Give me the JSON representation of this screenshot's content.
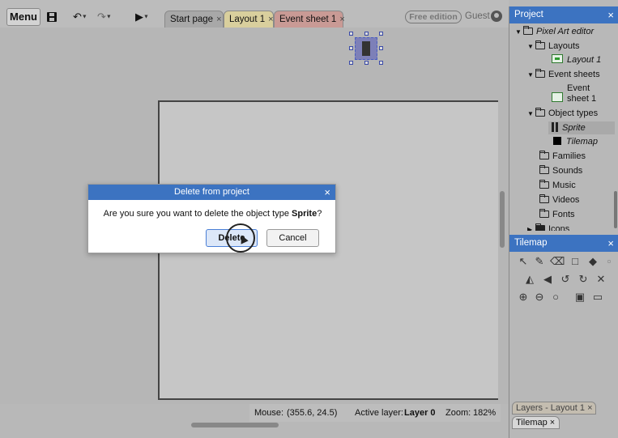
{
  "toolbar": {
    "menu_label": "Menu",
    "tabs": [
      {
        "label": "Start page",
        "close": "×"
      },
      {
        "label": "Layout 1",
        "close": "×"
      },
      {
        "label": "Event sheet 1",
        "close": "×"
      }
    ],
    "edition_badge": "Free edition",
    "user_label": "Guest"
  },
  "statusbar": {
    "mouse_label": "Mouse:",
    "mouse_value": "(355.6, 24.5)",
    "active_layer_label": "Active layer:",
    "active_layer_value": "Layer 0",
    "zoom_label": "Zoom:",
    "zoom_value": "182%"
  },
  "project_panel": {
    "title": "Project",
    "close": "×",
    "items": [
      {
        "label": "Pixel Art editor"
      },
      {
        "label": "Layouts"
      },
      {
        "label": "Layout 1"
      },
      {
        "label": "Event sheets"
      },
      {
        "label": "Event",
        "label2": "sheet 1"
      },
      {
        "label": "Object types"
      },
      {
        "label": "Sprite"
      },
      {
        "label": "Tilemap"
      },
      {
        "label": "Families"
      },
      {
        "label": "Sounds"
      },
      {
        "label": "Music"
      },
      {
        "label": "Videos"
      },
      {
        "label": "Fonts"
      },
      {
        "label": "Icons"
      }
    ]
  },
  "tilemap_panel": {
    "title": "Tilemap",
    "close": "×",
    "tabs": [
      {
        "label": "Layers - Layout 1",
        "close": "×"
      },
      {
        "label": "Tilemap",
        "close": "×"
      }
    ]
  },
  "dialog": {
    "title": "Delete from project",
    "close": "×",
    "message_prefix": "Are you sure you want to delete the object type ",
    "message_object": "Sprite",
    "message_suffix": "?",
    "delete_label": "Delete",
    "cancel_label": "Cancel"
  },
  "colors": {
    "header_blue": "#3c73c1",
    "layout_tab": "#d9cf9d",
    "event_tab": "#c99a95"
  }
}
